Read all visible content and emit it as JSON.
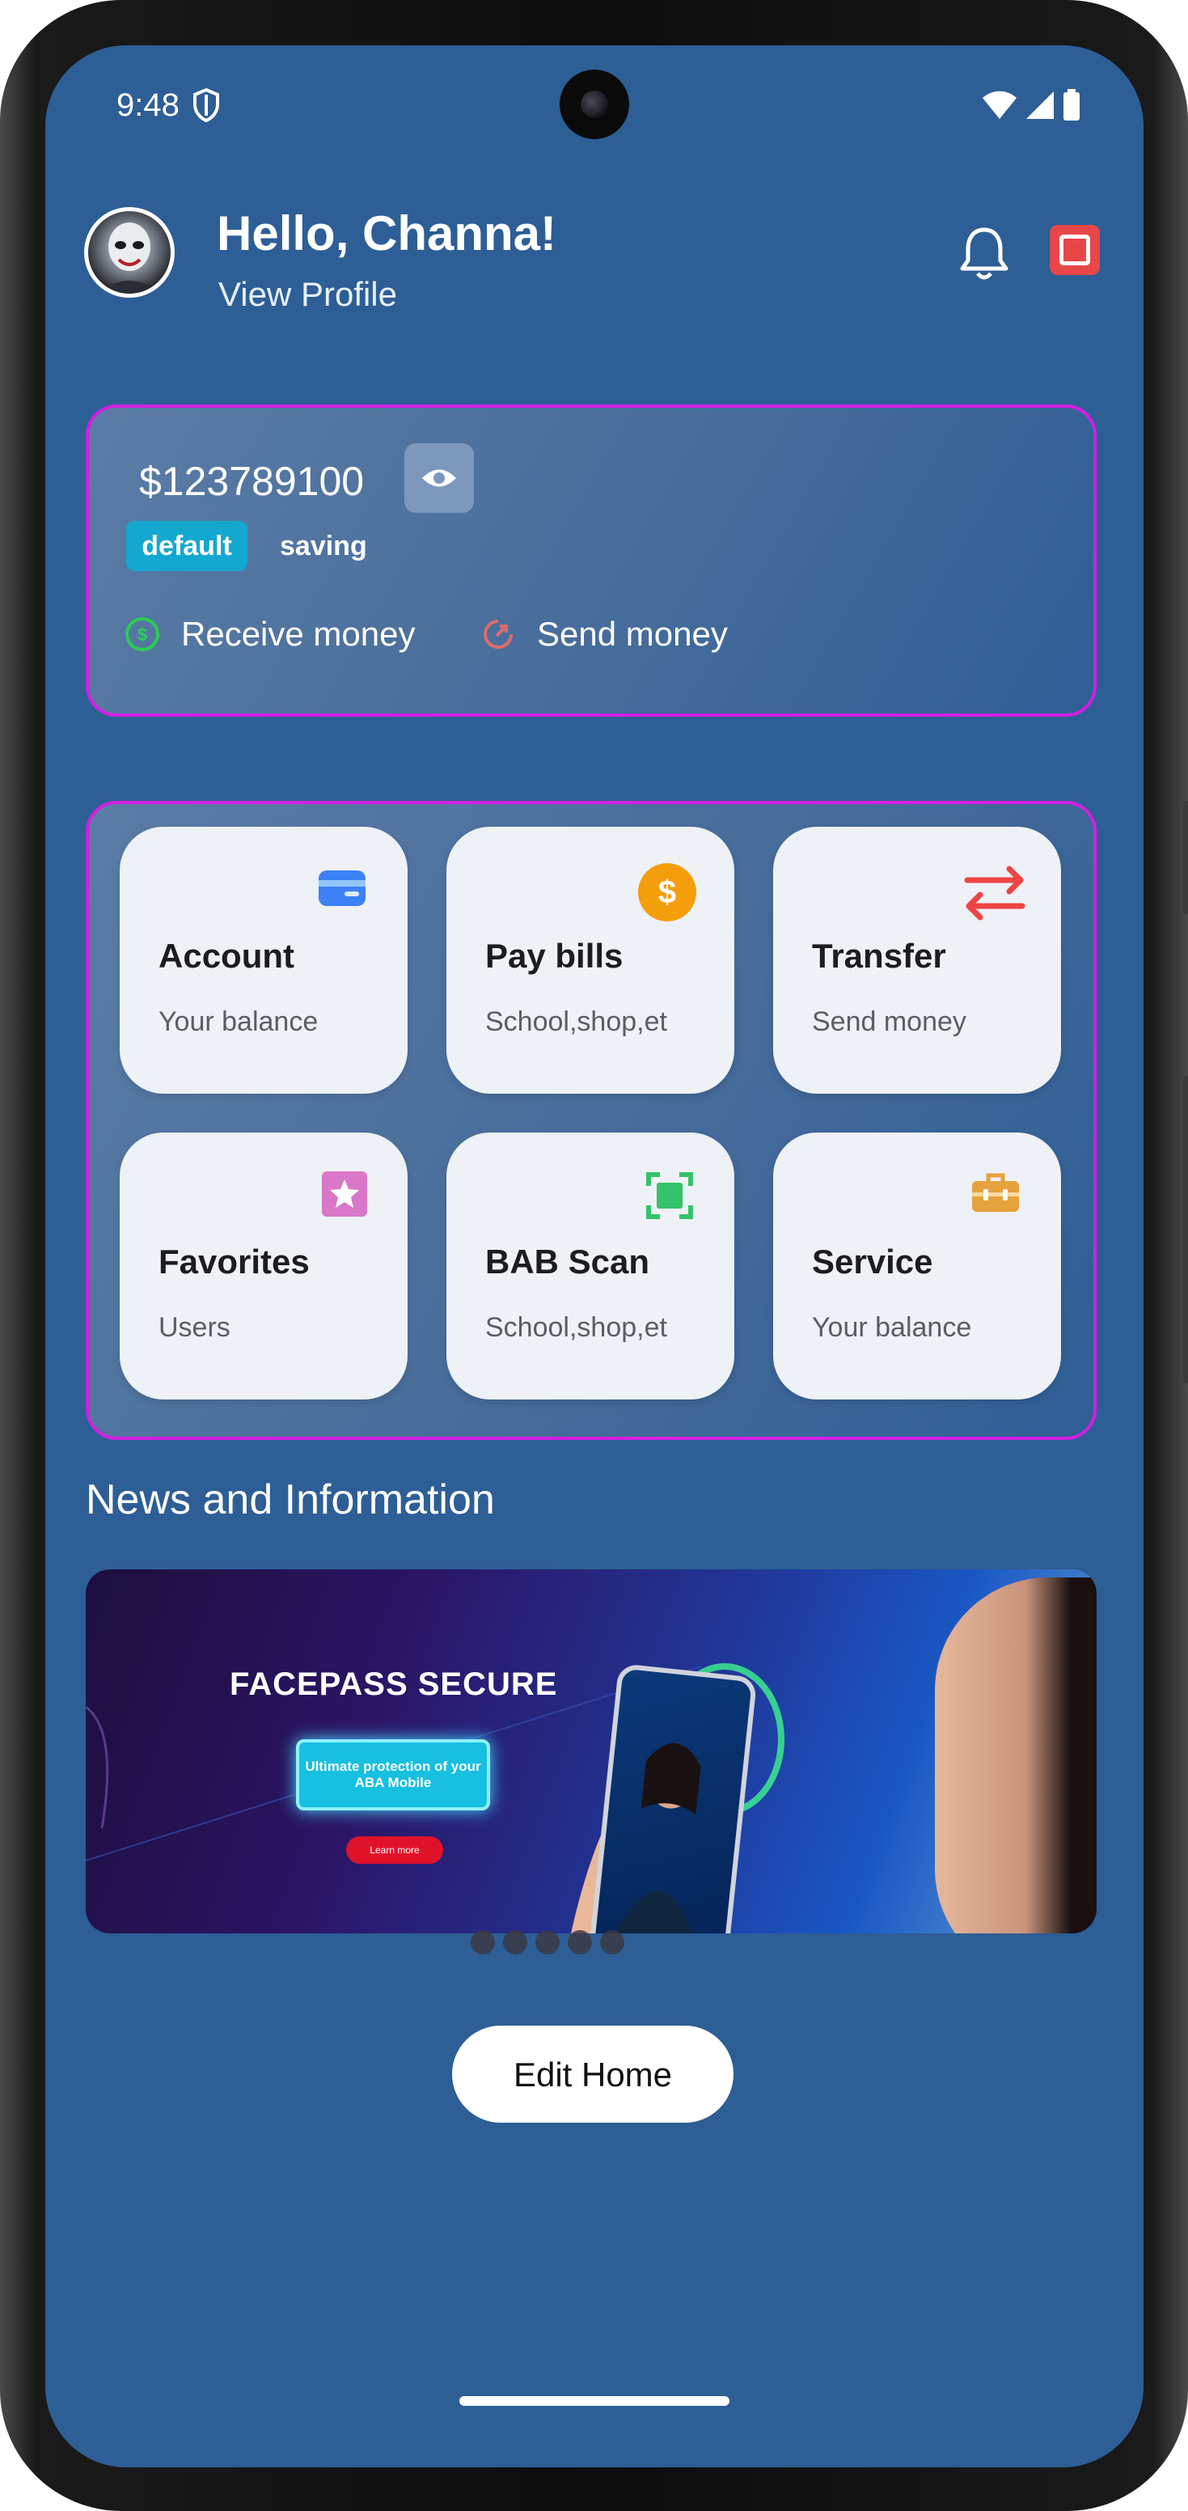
{
  "status": {
    "time": "9:48"
  },
  "header": {
    "greeting": "Hello, Channa!",
    "view_profile": "View Profile"
  },
  "balance": {
    "amount": "$123789100",
    "tag_default": "default",
    "tag_saving": "saving",
    "receive_label": "Receive money",
    "send_label": "Send money"
  },
  "services": [
    {
      "title": "Account",
      "subtitle": "Your balance",
      "icon": "wallet-icon",
      "color": "#3b82f6"
    },
    {
      "title": "Pay bills",
      "subtitle": "School,shop,et",
      "icon": "dollar-icon",
      "color": "#f59e0b"
    },
    {
      "title": "Transfer",
      "subtitle": "Send money",
      "icon": "transfer-arrows-icon",
      "color": "#ef4444"
    },
    {
      "title": "Favorites",
      "subtitle": "Users",
      "icon": "star-icon",
      "color": "#d978c9"
    },
    {
      "title": "BAB Scan",
      "subtitle": "School,shop,et",
      "icon": "scan-icon",
      "color": "#34c36a"
    },
    {
      "title": "Service",
      "subtitle": "Your balance",
      "icon": "toolbox-icon",
      "color": "#e6a23c"
    }
  ],
  "news": {
    "heading": "News and Information",
    "banner_title": "FACEPASS SECURE",
    "banner_protect": "Ultimate protection of your ABA Mobile",
    "banner_button": "Learn more"
  },
  "edit_home": "Edit Home"
}
